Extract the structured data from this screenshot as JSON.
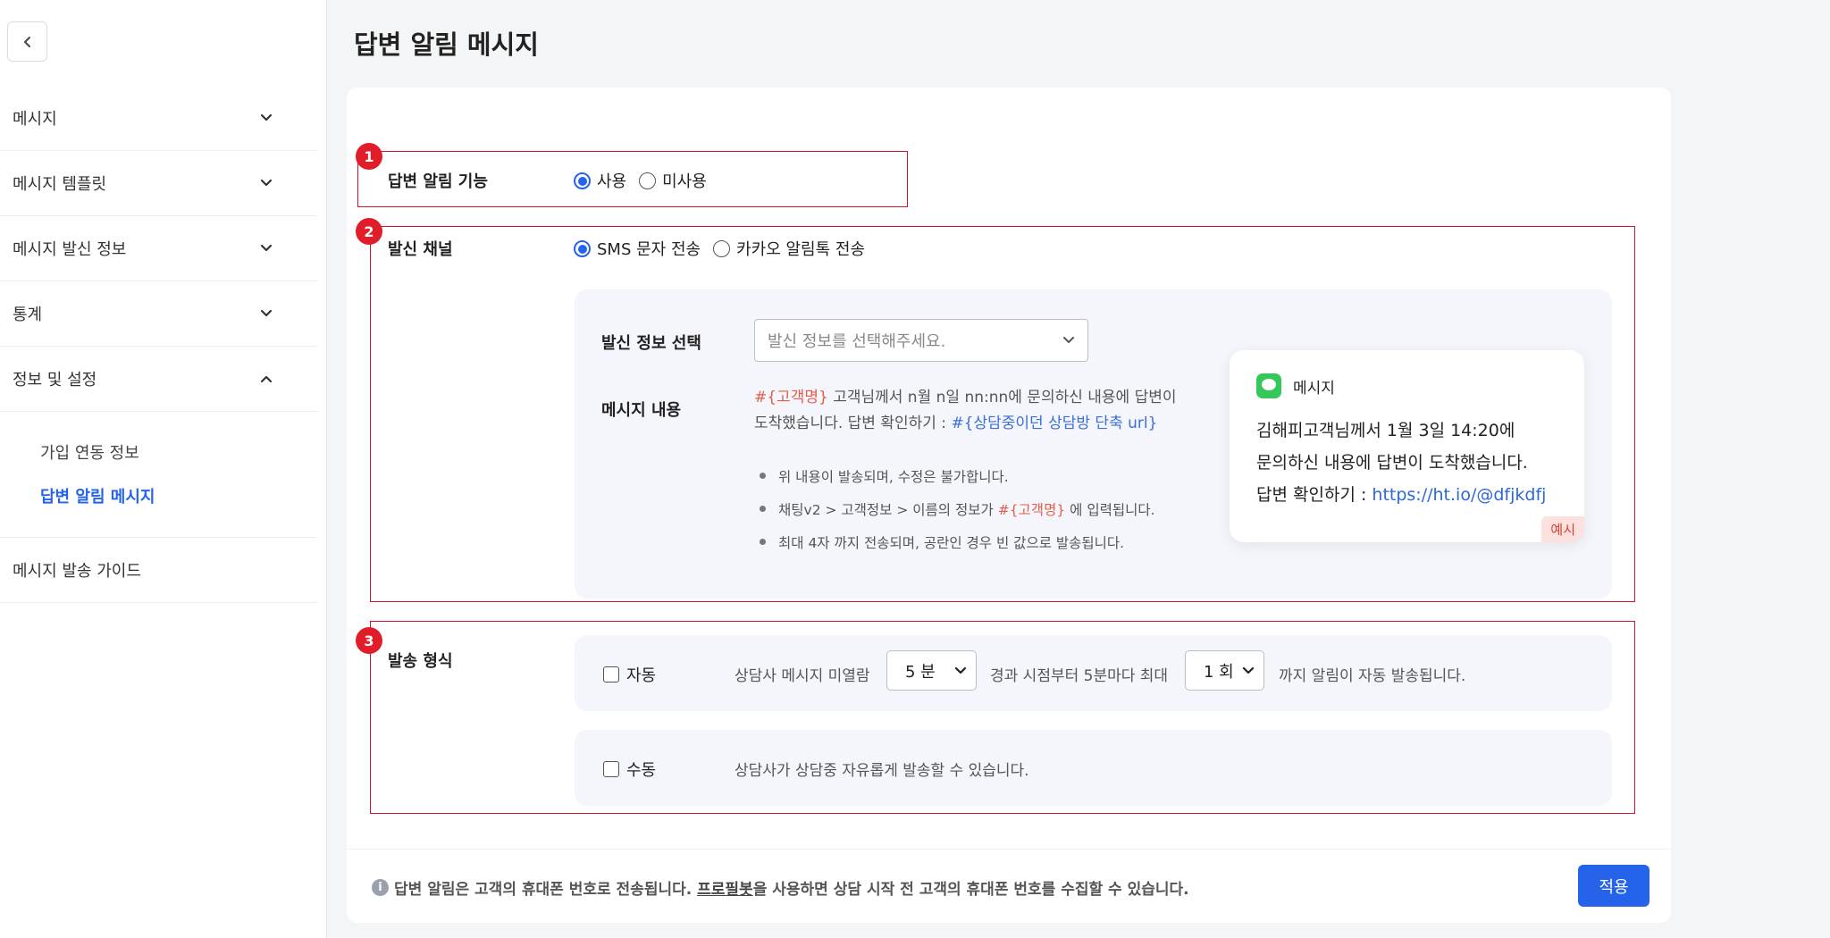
{
  "sidebar": {
    "menu": [
      {
        "label": "메시지"
      },
      {
        "label": "메시지 템플릿"
      },
      {
        "label": "메시지 발신 정보"
      },
      {
        "label": "통계"
      },
      {
        "label": "정보 및 설정"
      }
    ],
    "submenu": [
      {
        "label": "가입 연동 정보"
      },
      {
        "label": "답변 알림 메시지"
      }
    ],
    "guide": "메시지 발송 가이드"
  },
  "page": {
    "title": "답변 알림 메시지"
  },
  "badges": [
    "1",
    "2",
    "3"
  ],
  "feature": {
    "label": "답변 알림 기능",
    "options": [
      "사용",
      "미사용"
    ]
  },
  "channel": {
    "label": "발신 채널",
    "options": [
      "SMS 문자 전송",
      "카카오 알림톡 전송"
    ],
    "sender_label": "발신 정보 선택",
    "sender_placeholder": "발신 정보를 선택해주세요.",
    "content_label": "메시지 내용",
    "content": {
      "token_customer": "#{고객명}",
      "line1_rest": " 고객님께서 n월 n일 nn:nn에 문의하신 내용에 답변이",
      "line2_pre": "도착했습니다. 답변 확인하기 : ",
      "token_url": "#{상담중이던 상담방 단축 url}"
    },
    "notes": {
      "n1": "위 내용이 발송되며, 수정은 불가합니다.",
      "n2_pre": "채팅v2 > 고객정보 > 이름의 정보가 ",
      "n2_token": "#{고객명}",
      "n2_post": " 에 입력됩니다.",
      "n3": "최대 4자 까지 전송되며, 공란인 경우 빈 값으로 발송됩니다."
    },
    "preview": {
      "title": "메시지",
      "line1": "김해피고객님께서 1월 3일 14:20에",
      "line2": "문의하신 내용에 답변이 도착했습니다.",
      "line3_pre": "답변 확인하기 : ",
      "link": "https://ht.io/@dfjkdfj",
      "example_badge": "예시"
    }
  },
  "send_type": {
    "label": "발송 형식",
    "auto": {
      "label": "자동",
      "text1": "상담사 메시지 미열람",
      "minutes": "5 분",
      "text2": "경과 시점부터 5분마다 최대",
      "times": "1 회",
      "text3": "까지 알림이 자동 발송됩니다."
    },
    "manual": {
      "label": "수동",
      "text": "상담사가 상담중 자유롭게 발송할 수 있습니다."
    }
  },
  "footer": {
    "info_icon": "i",
    "note_pre": "답변 알림은 고객의 휴대폰 번호로 전송됩니다. ",
    "note_link": "프로필봇",
    "note_post": "을 사용하면 상담 시작 전 고객의 휴대폰 번호를 수집할 수 있습니다.",
    "apply": "적용"
  },
  "colors": {
    "accent": "#2563eb",
    "highlight_box": "#d0142c",
    "badge": "#e11d2a",
    "token_red": "#e35d4a",
    "token_blue": "#3b6fd8"
  }
}
